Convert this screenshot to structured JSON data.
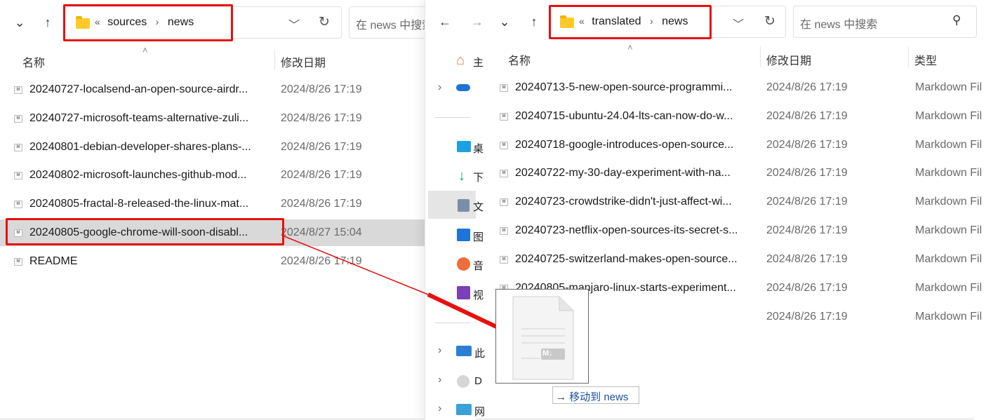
{
  "left_window": {
    "breadcrumb": {
      "prefix": "«",
      "parent": "sources",
      "separator": "›",
      "current": "news"
    },
    "search_placeholder": "在 news 中搜索",
    "columns": {
      "name": "名称",
      "modified": "修改日期"
    },
    "files": [
      {
        "name": "20240727-localsend-an-open-source-airdr...",
        "date": "2024/8/26 17:19"
      },
      {
        "name": "20240727-microsoft-teams-alternative-zuli...",
        "date": "2024/8/26 17:19"
      },
      {
        "name": "20240801-debian-developer-shares-plans-...",
        "date": "2024/8/26 17:19"
      },
      {
        "name": "20240802-microsoft-launches-github-mod...",
        "date": "2024/8/26 17:19"
      },
      {
        "name": "20240805-fractal-8-released-the-linux-mat...",
        "date": "2024/8/26 17:19"
      },
      {
        "name": "20240805-google-chrome-will-soon-disabl...",
        "date": "2024/8/27 15:04"
      },
      {
        "name": "README",
        "date": "2024/8/26 17:19"
      }
    ]
  },
  "right_window": {
    "breadcrumb": {
      "prefix": "«",
      "parent": "translated",
      "separator": "›",
      "current": "news"
    },
    "search_placeholder": "在 news 中搜索",
    "columns": {
      "name": "名称",
      "modified": "修改日期",
      "type": "类型"
    },
    "files": [
      {
        "name": "20240713-5-new-open-source-programmi...",
        "date": "2024/8/26 17:19",
        "type": "Markdown Fil"
      },
      {
        "name": "20240715-ubuntu-24.04-lts-can-now-do-w...",
        "date": "2024/8/26 17:19",
        "type": "Markdown Fil"
      },
      {
        "name": "20240718-google-introduces-open-source...",
        "date": "2024/8/26 17:19",
        "type": "Markdown Fil"
      },
      {
        "name": "20240722-my-30-day-experiment-with-na...",
        "date": "2024/8/26 17:19",
        "type": "Markdown Fil"
      },
      {
        "name": "20240723-crowdstrike-didn't-just-affect-wi...",
        "date": "2024/8/26 17:19",
        "type": "Markdown Fil"
      },
      {
        "name": "20240723-netflix-open-sources-its-secret-s...",
        "date": "2024/8/26 17:19",
        "type": "Markdown Fil"
      },
      {
        "name": "20240725-switzerland-makes-open-source...",
        "date": "2024/8/26 17:19",
        "type": "Markdown Fil"
      },
      {
        "name": "20240805-manjaro-linux-starts-experiment...",
        "date": "2024/8/26 17:19",
        "type": "Markdown Fil"
      },
      {
        "name": "",
        "date": "2024/8/26 17:19",
        "type": "Markdown Fil"
      }
    ],
    "sidebar_items": [
      {
        "label": "主",
        "icon": "home-icon"
      },
      {
        "label": "",
        "icon": "onedrive-icon"
      },
      {
        "label": "桌",
        "icon": "desktop-folder-icon"
      },
      {
        "label": "下",
        "icon": "downloads-icon"
      },
      {
        "label": "文",
        "icon": "documents-icon"
      },
      {
        "label": "图",
        "icon": "pictures-icon"
      },
      {
        "label": "音",
        "icon": "music-icon"
      },
      {
        "label": "视",
        "icon": "videos-icon"
      },
      {
        "label": "此",
        "icon": "this-pc-icon"
      },
      {
        "label": "D",
        "icon": "disc-drive-icon"
      },
      {
        "label": "网",
        "icon": "network-icon"
      }
    ]
  },
  "drag": {
    "ghost_badge": "M↓",
    "tooltip_arrow": "→",
    "tooltip_text": "移动到 news"
  },
  "colors": {
    "annotation_red": "#e81010",
    "selected_row": "#d9d9d9",
    "folder_yellow": "#ffca28"
  }
}
